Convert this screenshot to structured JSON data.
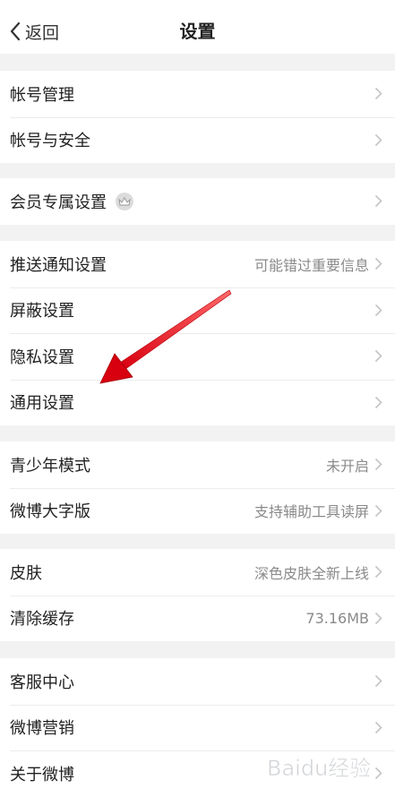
{
  "nav": {
    "back_label": "返回",
    "title": "设置"
  },
  "groups": [
    {
      "items": [
        {
          "label": "帐号管理"
        },
        {
          "label": "帐号与安全"
        }
      ]
    },
    {
      "items": [
        {
          "label": "会员专属设置",
          "icon": "crown-icon"
        }
      ]
    },
    {
      "items": [
        {
          "label": "推送通知设置",
          "value": "可能错过重要信息"
        },
        {
          "label": "屏蔽设置"
        },
        {
          "label": "隐私设置"
        },
        {
          "label": "通用设置"
        }
      ]
    },
    {
      "items": [
        {
          "label": "青少年模式",
          "value": "未开启"
        },
        {
          "label": "微博大字版",
          "value": "支持辅助工具读屏"
        }
      ]
    },
    {
      "items": [
        {
          "label": "皮肤",
          "value": "深色皮肤全新上线"
        },
        {
          "label": "清除缓存",
          "value": "73.16MB"
        }
      ]
    },
    {
      "items": [
        {
          "label": "客服中心"
        },
        {
          "label": "微博营销"
        },
        {
          "label": "关于微博"
        }
      ]
    }
  ],
  "annotation": {
    "arrow_color": "#e0121a",
    "points_to": "通用设置"
  },
  "watermark": {
    "text": "Baidu经验"
  }
}
